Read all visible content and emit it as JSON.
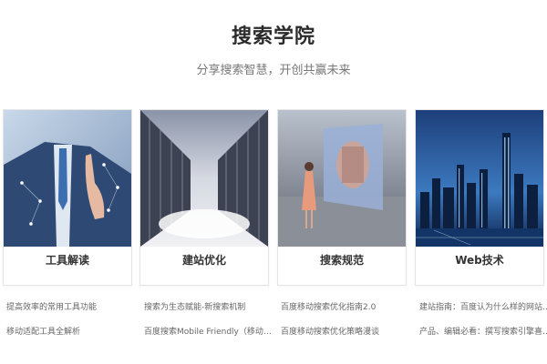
{
  "page": {
    "title": "搜索学院",
    "subtitle": "分享搜索智慧，开创共赢未来"
  },
  "cards": [
    {
      "label": "工具解读",
      "links": [
        "提高效率的常用工具功能",
        "移动适配工具全解析"
      ]
    },
    {
      "label": "建站优化",
      "links": [
        "搜索为生态赋能-新搜索机制",
        "百度搜索Mobile Friendly（移动友好度）..."
      ]
    },
    {
      "label": "搜索规范",
      "links": [
        "百度移动搜索优化指南2.0",
        "百度移动搜索优化策略漫谈"
      ]
    },
    {
      "label": "Web技术",
      "links": [
        "建站指南：百度认为什么样的网站更有...",
        "产品、编辑必看：撰写搜索引擎喜爱的..."
      ]
    }
  ]
}
